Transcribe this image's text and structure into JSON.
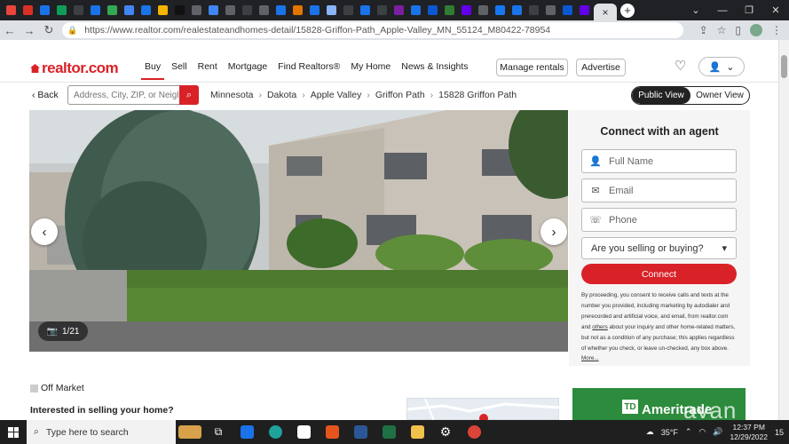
{
  "browser": {
    "tab_favicon_colors": [
      "#e8453c",
      "#d93025",
      "#1a73e8",
      "#0f9d58",
      "#3c4043",
      "#1a73e8",
      "#34a853",
      "#4285f4",
      "#1a73e8",
      "#f4b400",
      "#111111",
      "#5f6368",
      "#4285f4",
      "#5f6368",
      "#3c4043",
      "#5f6368",
      "#1a73e8",
      "#e37400",
      "#1a73e8",
      "#8ab4f8",
      "#3c4043",
      "#1a73e8",
      "#3c4043",
      "#7b1fa2",
      "#1a73e8",
      "#0b57d0",
      "#2e7d32",
      "#6200ea",
      "#5f6368",
      "#1877f2",
      "#1a73e8",
      "#3c4043",
      "#5f6368",
      "#0b57d0",
      "#6200ea"
    ],
    "active_tab_close": "×",
    "new_tab": "+",
    "url": "https://www.realtor.com/realestateandhomes-detail/15828-Griffon-Path_Apple-Valley_MN_55124_M80422-78954"
  },
  "site": {
    "logo": "realtor.com",
    "nav": [
      {
        "label": "Buy"
      },
      {
        "label": "Sell"
      },
      {
        "label": "Rent"
      },
      {
        "label": "Mortgage"
      },
      {
        "label": "Find Realtors®"
      },
      {
        "label": "My Home"
      },
      {
        "label": "News & Insights"
      }
    ],
    "manage_rentals": "Manage rentals",
    "advertise": "Advertise",
    "back_label": "Back",
    "search_placeholder": "Address, City, ZIP, or Neighborhood",
    "breadcrumbs": [
      "Minnesota",
      "Dakota",
      "Apple Valley",
      "Griffon Path",
      "15828 Griffon Path"
    ],
    "public_view": "Public View",
    "owner_view": "Owner View",
    "photo_counter": "1/21"
  },
  "agent_form": {
    "title": "Connect with an agent",
    "full_name_placeholder": "Full Name",
    "email_placeholder": "Email",
    "phone_placeholder": "Phone",
    "selling_buying": "Are you selling or buying?",
    "connect_label": "Connect",
    "disclaimer_a": "By proceeding, you consent to receive calls and texts at the number you provided, including marketing by autodialer and prerecorded and artificial voice, and email, from realtor.com and ",
    "disclaimer_link": "others",
    "disclaimer_b": " about your inquiry and other home-related matters, but not as a condition of any purchase; this applies regardless of whether you check, or leave un-checked, any box above. ",
    "disclaimer_more": "More..."
  },
  "listing": {
    "status": "Off Market",
    "interested": "Interested in selling your home?"
  },
  "ad": {
    "logo_mark": "TD",
    "brand": "Ameritrade",
    "watermark": "avan"
  },
  "taskbar": {
    "search_placeholder": "Type here to search",
    "temperature": "35°F",
    "time": "12:37 PM",
    "date": "12/29/2022",
    "notification_count": "15"
  },
  "colors": {
    "brand_red": "#d92228",
    "ad_green": "#2c8b3c"
  }
}
